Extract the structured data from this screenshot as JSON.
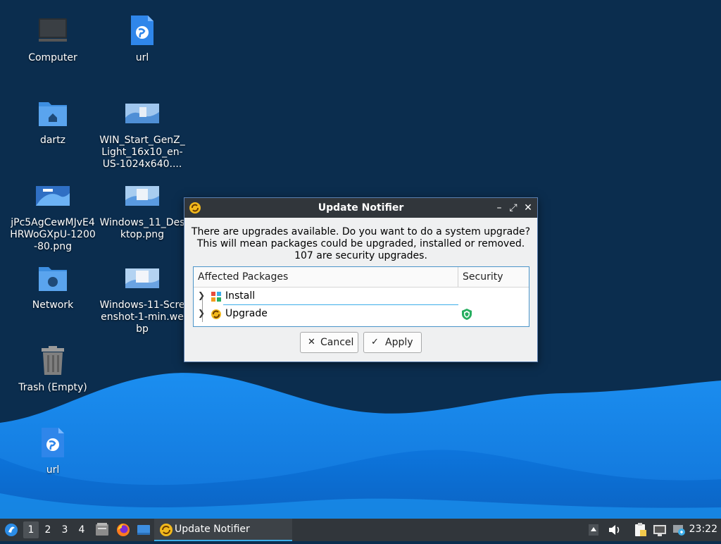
{
  "desktop": {
    "icons": [
      {
        "label": "Computer"
      },
      {
        "label": "url"
      },
      {
        "label": "dartz"
      },
      {
        "label": "WIN_Start_GenZ_Light_16x10_en-US-1024x640...."
      },
      {
        "label": "jPc5AgCewMJvE4HRWoGXpU-1200-80.png"
      },
      {
        "label": "Windows_11_Desktop.png"
      },
      {
        "label": "Network"
      },
      {
        "label": "Windows-11-Screenshot-1-min.webp"
      },
      {
        "label": "Trash (Empty)"
      },
      {
        "label": "url"
      }
    ]
  },
  "dialog": {
    "title": "Update Notifier",
    "message_line1": "There are upgrades available. Do you want to do a system upgrade?",
    "message_line2": "This will mean packages could be upgraded, installed or removed.",
    "message_line3": "107 are security upgrades.",
    "tree": {
      "col_packages": "Affected Packages",
      "col_security": "Security",
      "rows": [
        {
          "label": "Install"
        },
        {
          "label": "Upgrade"
        }
      ]
    },
    "cancel_label": "Cancel",
    "apply_label": "Apply"
  },
  "taskbar": {
    "workspaces": [
      "1",
      "2",
      "3",
      "4"
    ],
    "active_task": "Update Notifier",
    "clock": "23:22"
  },
  "colors": {
    "desktop_bg": "#0b2d4e",
    "wave": "#1a8ff0",
    "accent": "#3daee9",
    "titlebar": "#31363b"
  }
}
